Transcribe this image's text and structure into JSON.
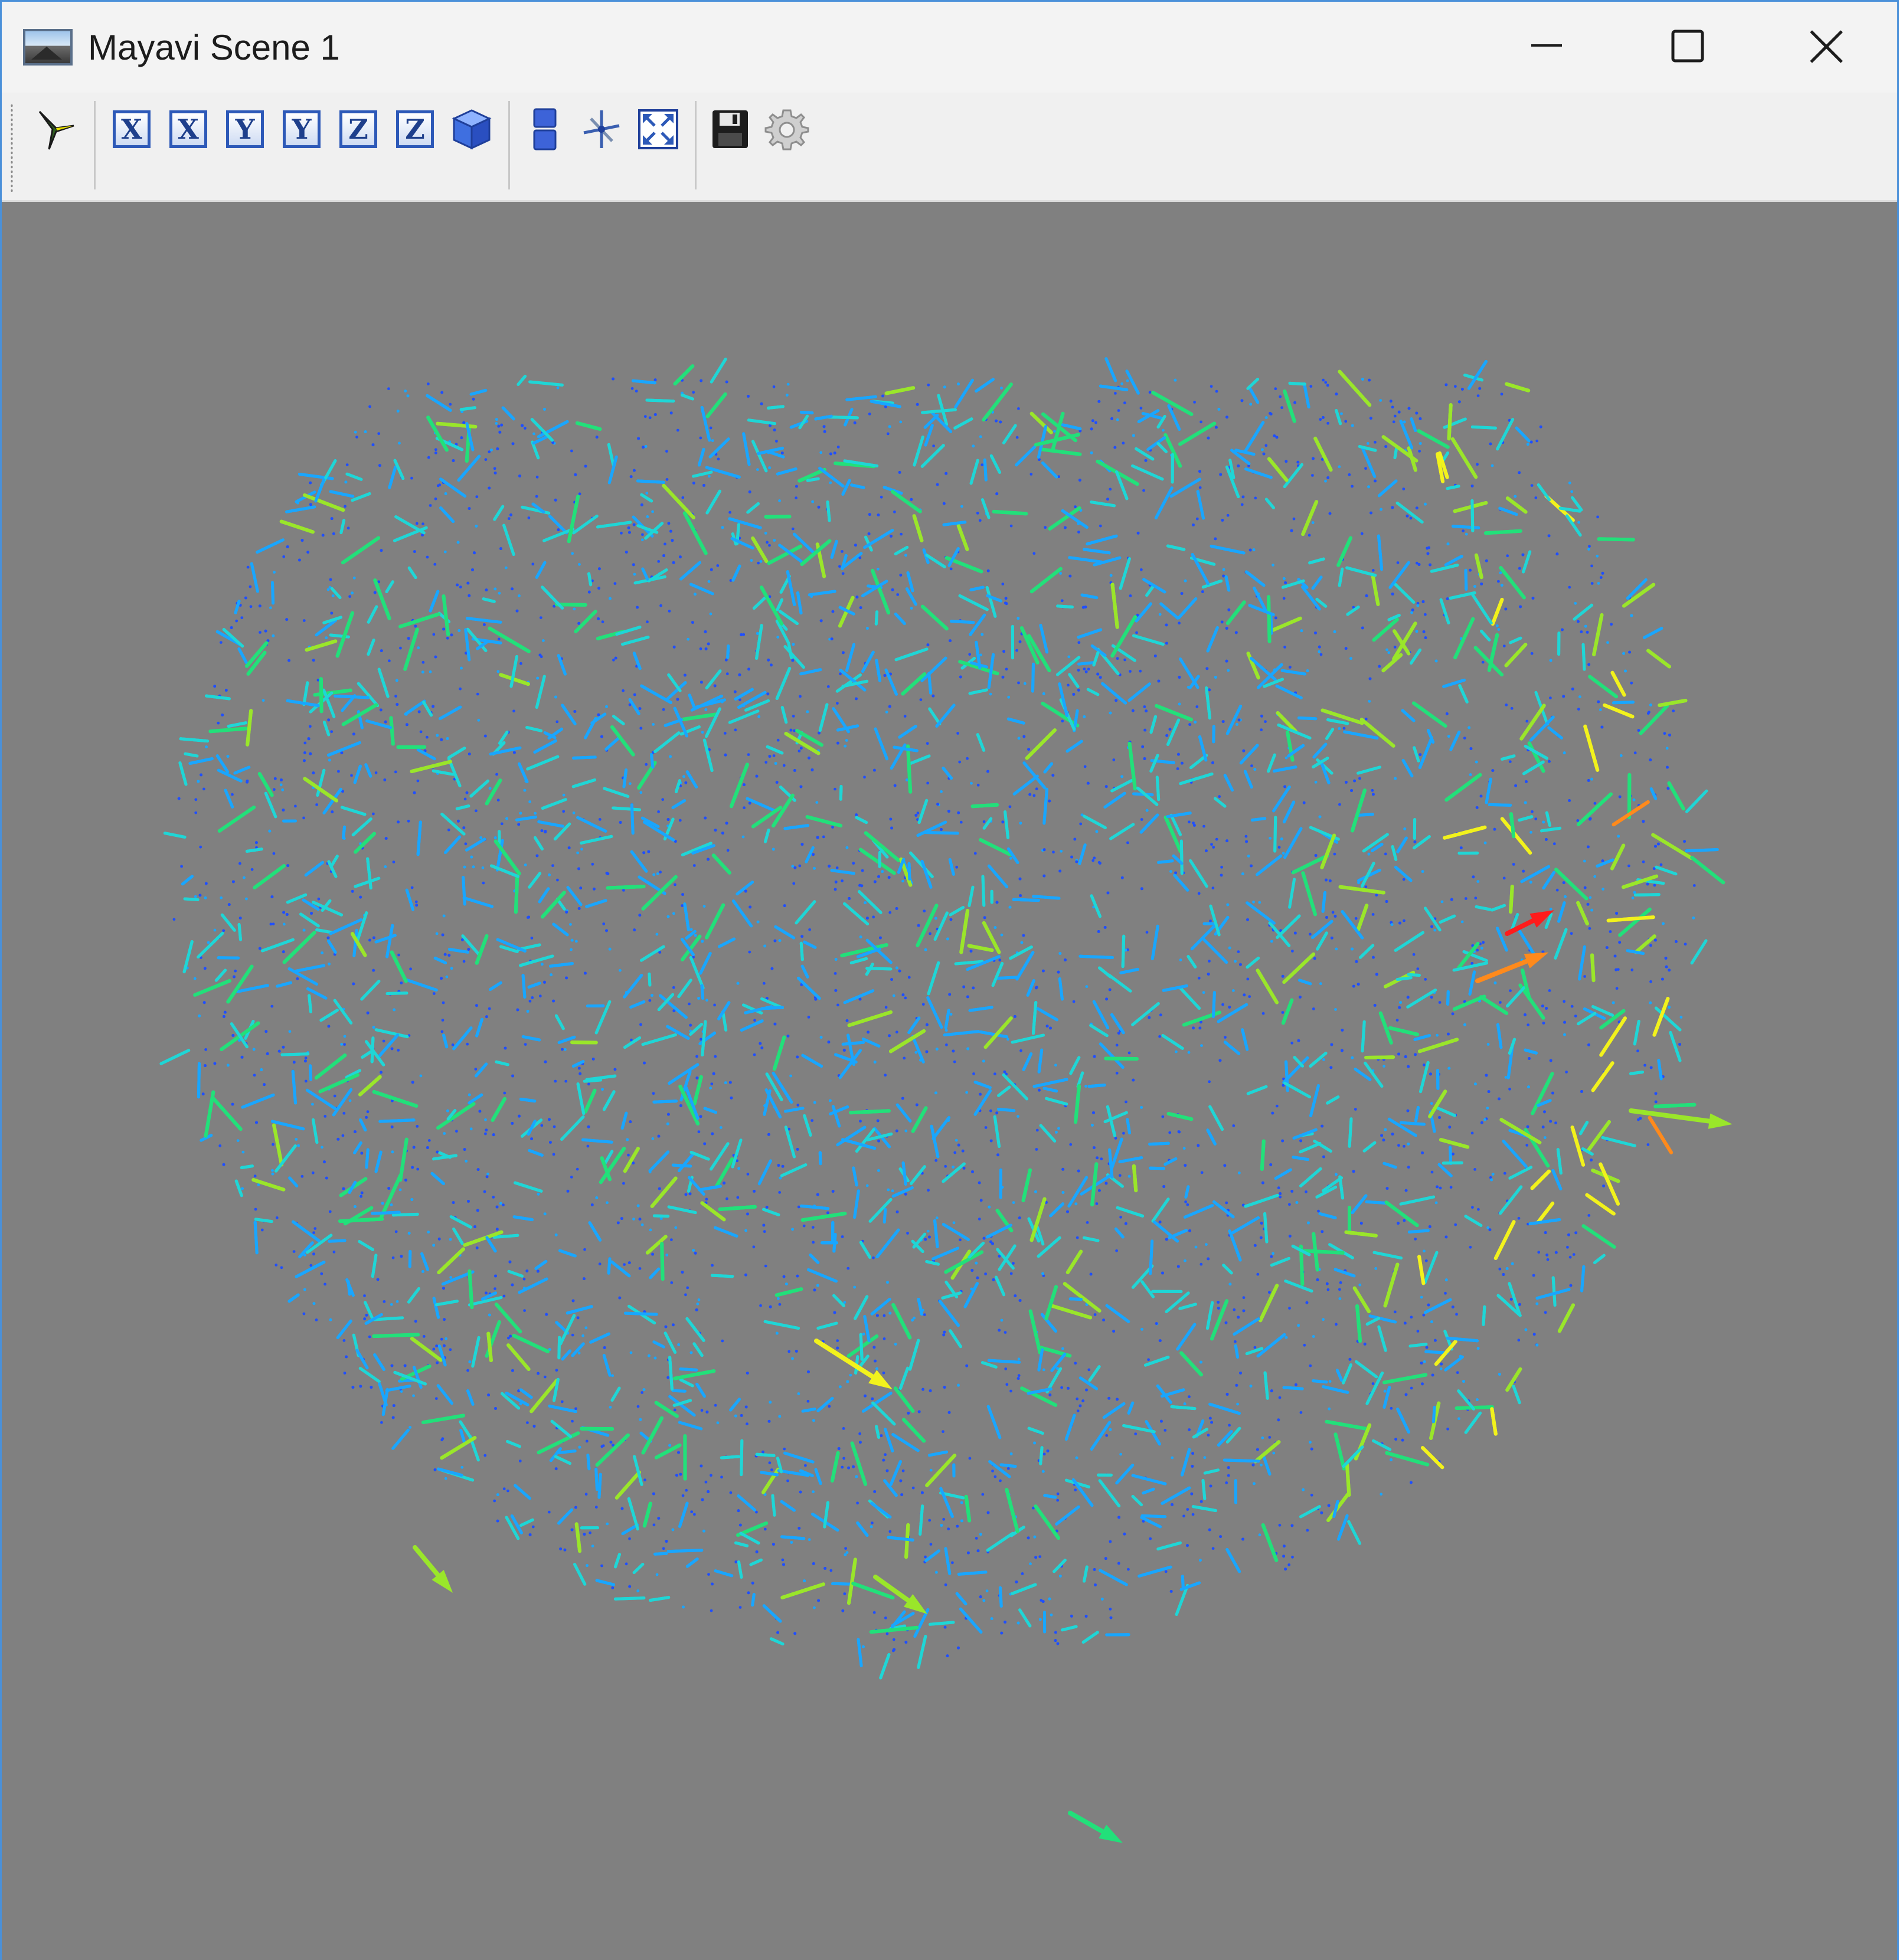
{
  "window": {
    "title": "Mayavi Scene 1",
    "app_icon": "landscape-picture-icon",
    "controls": {
      "minimize_icon": "minimize-icon",
      "maximize_icon": "maximize-icon",
      "close_icon": "close-icon"
    }
  },
  "toolbar": {
    "groups": [
      [
        "mayavi-pipeline-icon"
      ],
      [
        "view-x-plus-icon",
        "view-x-minus-icon",
        "view-y-plus-icon",
        "view-y-minus-icon",
        "view-z-plus-icon",
        "view-z-minus-icon",
        "isometric-view-icon"
      ],
      [
        "parallel-projection-icon",
        "axes-indicator-icon",
        "fullscreen-icon"
      ],
      [
        "save-icon",
        "settings-icon"
      ]
    ],
    "axis_labels": [
      "X",
      "X",
      "Y",
      "Y",
      "Z",
      "Z"
    ]
  },
  "scene": {
    "background_color": "#808080",
    "content": "vector field glyphs (arrows) on point cloud",
    "colormap": [
      "#1f4fff",
      "#19a6ff",
      "#1fd6d6",
      "#22e07a",
      "#9ae62a",
      "#f2f21c",
      "#ff8a1c",
      "#ff1c1c"
    ]
  }
}
